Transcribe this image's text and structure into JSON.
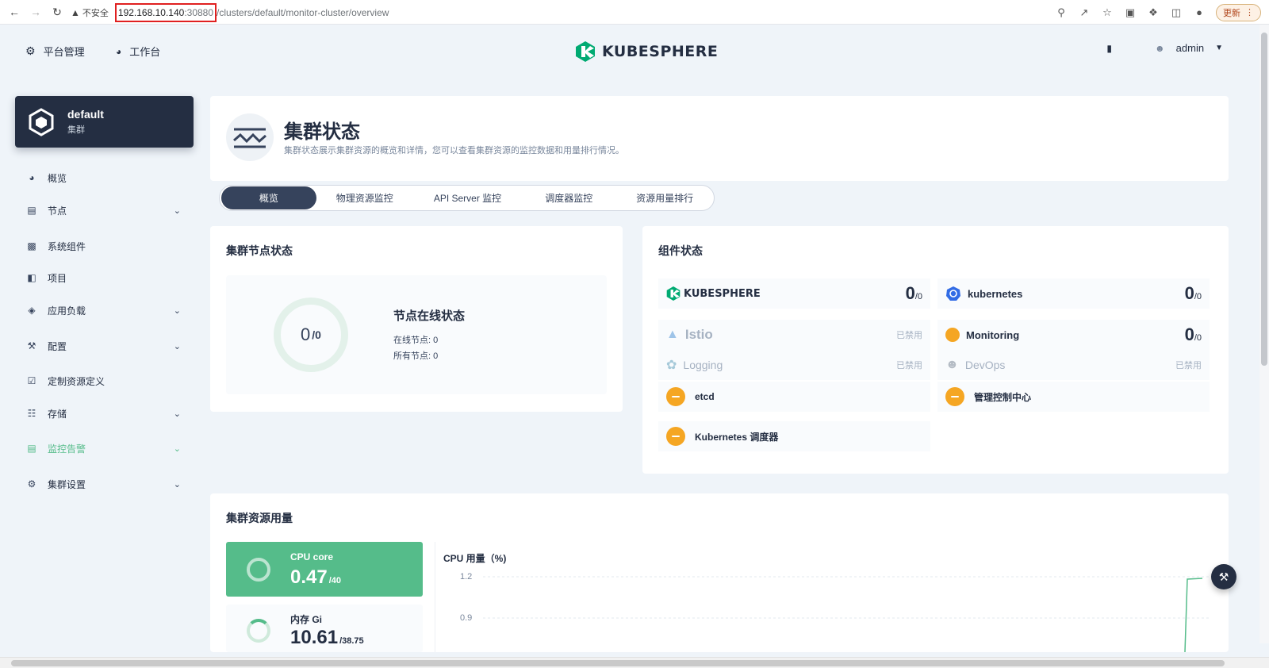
{
  "browser": {
    "insecure_label": "不安全",
    "url_host": "192.168.10.140",
    "url_port": ":30880",
    "url_path": "/clusters/default/monitor-cluster/overview",
    "update_label": "更新"
  },
  "header": {
    "platform_label": "平台管理",
    "workbench_label": "工作台",
    "logo_text": "KUBESPHERE",
    "user_name": "admin"
  },
  "cluster": {
    "name": "default",
    "type": "集群"
  },
  "sidebar": {
    "items": [
      {
        "label": "概览",
        "icon": "dashboard-icon"
      },
      {
        "label": "节点",
        "icon": "nodes-icon"
      },
      {
        "label": "系统组件",
        "icon": "components-icon"
      },
      {
        "label": "项目",
        "icon": "project-icon"
      },
      {
        "label": "应用负载",
        "icon": "appstore-icon"
      },
      {
        "label": "配置",
        "icon": "hammer-icon"
      },
      {
        "label": "定制资源定义",
        "icon": "crd-icon"
      },
      {
        "label": "存储",
        "icon": "storage-icon"
      },
      {
        "label": "监控告警",
        "icon": "monitor-icon"
      },
      {
        "label": "集群设置",
        "icon": "settings-icon"
      }
    ],
    "active_color": "#55bc8a"
  },
  "page": {
    "title": "集群状态",
    "description": "集群状态展示集群资源的概览和详情，您可以查看集群资源的监控数据和用量排行情况。"
  },
  "tabs": [
    "概览",
    "物理资源监控",
    "API Server 监控",
    "调度器监控",
    "资源用量排行"
  ],
  "node_status": {
    "section_title": "集群节点状态",
    "ring_value": "0",
    "ring_total": "/0",
    "title": "节点在线状态",
    "online_line": "在线节点: 0",
    "all_line": "所有节点: 0"
  },
  "components": {
    "section_title": "组件状态",
    "kubesphere": {
      "name": "KUBESPHERE",
      "value": "0",
      "total": "/0"
    },
    "kubernetes": {
      "name": "kubernetes",
      "value": "0",
      "total": "/0"
    },
    "istio": {
      "name": "Istio",
      "status": "已禁用"
    },
    "monitoring": {
      "name": "Monitoring",
      "value": "0",
      "total": "/0"
    },
    "logging": {
      "name": "Logging",
      "status": "已禁用"
    },
    "devops": {
      "name": "DevOps",
      "status": "已禁用"
    },
    "etcd": {
      "name": "etcd"
    },
    "controller": {
      "name": "管理控制中心"
    },
    "scheduler": {
      "name": "Kubernetes 调度器"
    },
    "warn_color": "#f5a623"
  },
  "resources": {
    "section_title": "集群资源用量",
    "cpu": {
      "label": "CPU core",
      "value": "0.47",
      "total": "/40"
    },
    "memory": {
      "label": "内存 Gi",
      "value": "10.61",
      "total": "/38.75"
    },
    "chart_title": "CPU 用量（%)",
    "ticks": [
      "1.2",
      "0.9"
    ]
  }
}
